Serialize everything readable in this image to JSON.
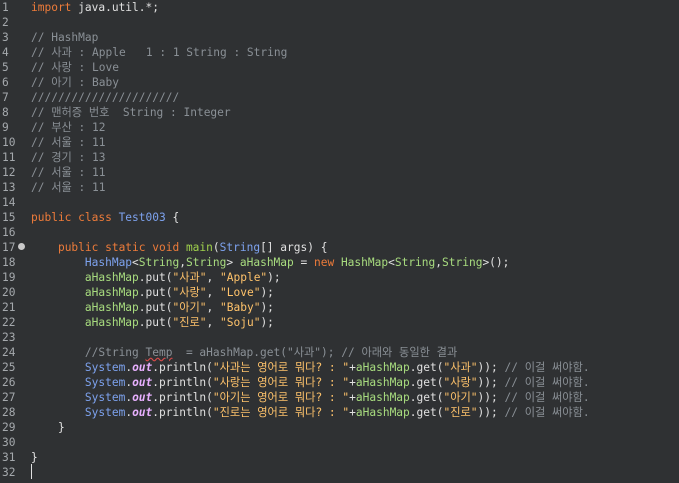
{
  "editor": {
    "line_numbers": [
      "1",
      "2",
      "3",
      "4",
      "5",
      "6",
      "7",
      "8",
      "9",
      "10",
      "11",
      "12",
      "13",
      "14",
      "15",
      "16",
      "17",
      "18",
      "19",
      "20",
      "21",
      "22",
      "23",
      "24",
      "25",
      "26",
      "27",
      "28",
      "29",
      "30",
      "31",
      "32"
    ],
    "lines": [
      [
        {
          "t": "kw",
          "v": "import"
        },
        {
          "t": "var",
          "v": " java.util.*;"
        }
      ],
      [],
      [
        {
          "t": "cm",
          "v": "// HashMap"
        }
      ],
      [
        {
          "t": "cm",
          "v": "// 사과 : Apple   1 : 1 String : String"
        }
      ],
      [
        {
          "t": "cm",
          "v": "// 사랑 : Love"
        }
      ],
      [
        {
          "t": "cm",
          "v": "// 아기 : Baby"
        }
      ],
      [
        {
          "t": "cm",
          "v": "//////////////////////"
        }
      ],
      [
        {
          "t": "cm",
          "v": "// 맨허증 번호  String : Integer"
        }
      ],
      [
        {
          "t": "cm",
          "v": "// 부산 : 12"
        }
      ],
      [
        {
          "t": "cm",
          "v": "// 서울 : 11"
        }
      ],
      [
        {
          "t": "cm",
          "v": "// 경기 : 13"
        }
      ],
      [
        {
          "t": "cm",
          "v": "// 서울 : 11"
        }
      ],
      [
        {
          "t": "cm",
          "v": "// 서울 : 11"
        }
      ],
      [],
      [
        {
          "t": "kw",
          "v": "public class "
        },
        {
          "t": "cls",
          "v": "Test003"
        },
        {
          "t": "var",
          "v": " {"
        }
      ],
      [],
      [
        {
          "t": "var",
          "v": "    "
        },
        {
          "t": "kw",
          "v": "public static void "
        },
        {
          "t": "fn",
          "v": "main"
        },
        {
          "t": "var",
          "v": "("
        },
        {
          "t": "cls",
          "v": "String"
        },
        {
          "t": "var",
          "v": "[] "
        },
        {
          "t": "sf2",
          "v": "args"
        },
        {
          "t": "var",
          "v": ") {"
        }
      ],
      [
        {
          "t": "var",
          "v": "        "
        },
        {
          "t": "cls",
          "v": "HashMap"
        },
        {
          "t": "var",
          "v": "<"
        },
        {
          "t": "ty",
          "v": "String"
        },
        {
          "t": "var",
          "v": ","
        },
        {
          "t": "ty",
          "v": "String"
        },
        {
          "t": "var",
          "v": "> "
        },
        {
          "t": "ty",
          "v": "aHashMap"
        },
        {
          "t": "var",
          "v": " = "
        },
        {
          "t": "kw",
          "v": "new "
        },
        {
          "t": "ty",
          "v": "HashMap"
        },
        {
          "t": "var",
          "v": "<"
        },
        {
          "t": "ty",
          "v": "String"
        },
        {
          "t": "var",
          "v": ","
        },
        {
          "t": "ty",
          "v": "String"
        },
        {
          "t": "var",
          "v": ">();"
        }
      ],
      [
        {
          "t": "var",
          "v": "        "
        },
        {
          "t": "ty",
          "v": "aHashMap"
        },
        {
          "t": "var",
          "v": ".put("
        },
        {
          "t": "st",
          "v": "\"사과\""
        },
        {
          "t": "var",
          "v": ", "
        },
        {
          "t": "st",
          "v": "\"Apple\""
        },
        {
          "t": "var",
          "v": ");"
        }
      ],
      [
        {
          "t": "var",
          "v": "        "
        },
        {
          "t": "ty",
          "v": "aHashMap"
        },
        {
          "t": "var",
          "v": ".put("
        },
        {
          "t": "st",
          "v": "\"사랑\""
        },
        {
          "t": "var",
          "v": ", "
        },
        {
          "t": "st",
          "v": "\"Love\""
        },
        {
          "t": "var",
          "v": ");"
        }
      ],
      [
        {
          "t": "var",
          "v": "        "
        },
        {
          "t": "ty",
          "v": "aHashMap"
        },
        {
          "t": "var",
          "v": ".put("
        },
        {
          "t": "st",
          "v": "\"아기\""
        },
        {
          "t": "var",
          "v": ", "
        },
        {
          "t": "st",
          "v": "\"Baby\""
        },
        {
          "t": "var",
          "v": ");"
        }
      ],
      [
        {
          "t": "var",
          "v": "        "
        },
        {
          "t": "ty",
          "v": "aHashMap"
        },
        {
          "t": "var",
          "v": ".put("
        },
        {
          "t": "st",
          "v": "\"진로\""
        },
        {
          "t": "var",
          "v": ", "
        },
        {
          "t": "st",
          "v": "\"Soju\""
        },
        {
          "t": "var",
          "v": ");"
        }
      ],
      [],
      [
        {
          "t": "var",
          "v": "        "
        },
        {
          "t": "cm",
          "v": "//String "
        },
        {
          "t": "cmerr",
          "v": "Temp"
        },
        {
          "t": "cm",
          "v": "  = aHashMap.get(\"사과\"); // 아래와 동일한 결과"
        }
      ],
      [
        {
          "t": "var",
          "v": "        "
        },
        {
          "t": "cls",
          "v": "System"
        },
        {
          "t": "var",
          "v": "."
        },
        {
          "t": "sf",
          "v": "out"
        },
        {
          "t": "var",
          "v": ".println("
        },
        {
          "t": "st",
          "v": "\"사과는 영어로 뭐다? : \""
        },
        {
          "t": "var",
          "v": "+"
        },
        {
          "t": "ty",
          "v": "aHashMap"
        },
        {
          "t": "var",
          "v": ".get("
        },
        {
          "t": "st",
          "v": "\"사과\""
        },
        {
          "t": "var",
          "v": ")); "
        },
        {
          "t": "cm",
          "v": "// 이걸 써야함."
        }
      ],
      [
        {
          "t": "var",
          "v": "        "
        },
        {
          "t": "cls",
          "v": "System"
        },
        {
          "t": "var",
          "v": "."
        },
        {
          "t": "sf",
          "v": "out"
        },
        {
          "t": "var",
          "v": ".println("
        },
        {
          "t": "st",
          "v": "\"사랑는 영어로 뭐다? : \""
        },
        {
          "t": "var",
          "v": "+"
        },
        {
          "t": "ty",
          "v": "aHashMap"
        },
        {
          "t": "var",
          "v": ".get("
        },
        {
          "t": "st",
          "v": "\"사랑\""
        },
        {
          "t": "var",
          "v": ")); "
        },
        {
          "t": "cm",
          "v": "// 이걸 써야함."
        }
      ],
      [
        {
          "t": "var",
          "v": "        "
        },
        {
          "t": "cls",
          "v": "System"
        },
        {
          "t": "var",
          "v": "."
        },
        {
          "t": "sf",
          "v": "out"
        },
        {
          "t": "var",
          "v": ".println("
        },
        {
          "t": "st",
          "v": "\"아기는 영어로 뭐다? : \""
        },
        {
          "t": "var",
          "v": "+"
        },
        {
          "t": "ty",
          "v": "aHashMap"
        },
        {
          "t": "var",
          "v": ".get("
        },
        {
          "t": "st",
          "v": "\"아기\""
        },
        {
          "t": "var",
          "v": ")); "
        },
        {
          "t": "cm",
          "v": "// 이걸 써야함."
        }
      ],
      [
        {
          "t": "var",
          "v": "        "
        },
        {
          "t": "cls",
          "v": "System"
        },
        {
          "t": "var",
          "v": "."
        },
        {
          "t": "sf",
          "v": "out"
        },
        {
          "t": "var",
          "v": ".println("
        },
        {
          "t": "st",
          "v": "\"진로는 영어로 뭐다? : \""
        },
        {
          "t": "var",
          "v": "+"
        },
        {
          "t": "ty",
          "v": "aHashMap"
        },
        {
          "t": "var",
          "v": ".get("
        },
        {
          "t": "st",
          "v": "\"진로\""
        },
        {
          "t": "var",
          "v": ")); "
        },
        {
          "t": "cm",
          "v": "// 이걸 써야함."
        }
      ],
      [
        {
          "t": "var",
          "v": "    }"
        }
      ],
      [],
      [
        {
          "t": "var",
          "v": "}"
        }
      ],
      []
    ],
    "colors": {
      "background": "#2f3133",
      "keyword": "#ed7b3a",
      "comment": "#8a9096",
      "class": "#7da2ee",
      "string": "#ffc36b",
      "text": "#e7e7e7"
    }
  }
}
